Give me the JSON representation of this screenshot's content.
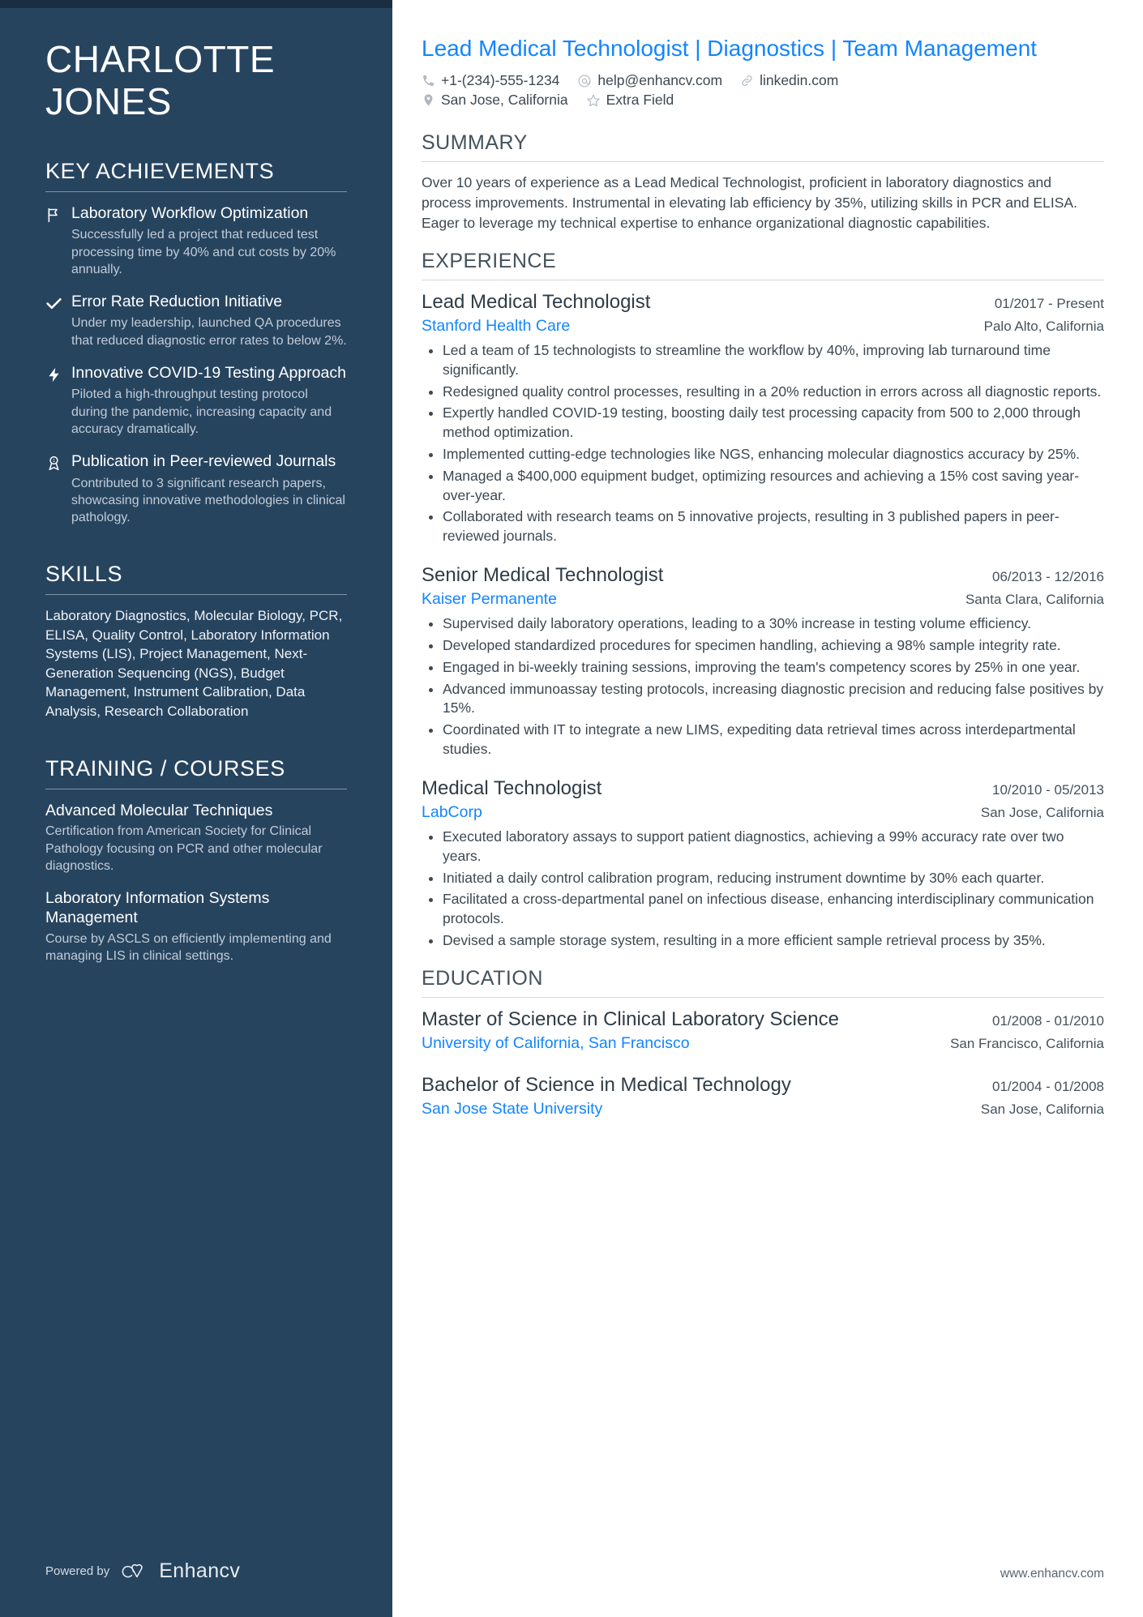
{
  "sidebar": {
    "name_lines": [
      "CHARLOTTE",
      "JONES"
    ],
    "achievements_heading": "KEY ACHIEVEMENTS",
    "achievements": [
      {
        "icon": "flag-icon",
        "title": "Laboratory Workflow Optimization",
        "description": "Successfully led a project that reduced test processing time by 40% and cut costs by 20% annually."
      },
      {
        "icon": "check-icon",
        "title": "Error Rate Reduction Initiative",
        "description": "Under my leadership, launched QA procedures that reduced diagnostic error rates to below 2%."
      },
      {
        "icon": "lightning-bolt-icon",
        "title": "Innovative COVID-19 Testing Approach",
        "description": "Piloted a high-throughput testing protocol during the pandemic, increasing capacity and accuracy dramatically."
      },
      {
        "icon": "award-ribbon-icon",
        "title": "Publication in Peer-reviewed Journals",
        "description": "Contributed to 3 significant research papers, showcasing innovative methodologies in clinical pathology."
      }
    ],
    "skills_heading": "SKILLS",
    "skills_text": "Laboratory Diagnostics, Molecular Biology, PCR, ELISA, Quality Control, Laboratory Information Systems (LIS), Project Management, Next-Generation Sequencing (NGS), Budget Management, Instrument Calibration, Data Analysis, Research Collaboration",
    "training_heading": "TRAINING / COURSES",
    "courses": [
      {
        "title": "Advanced Molecular Techniques",
        "description": "Certification from American Society for Clinical Pathology focusing on PCR and other molecular diagnostics."
      },
      {
        "title": "Laboratory Information Systems Management",
        "description": "Course by ASCLS on efficiently implementing and managing LIS in clinical settings."
      }
    ],
    "footer": {
      "powered_by": "Powered by",
      "brand": "Enhancv"
    }
  },
  "main": {
    "headline": "Lead Medical Technologist | Diagnostics | Team Management",
    "contacts_row1": [
      {
        "icon": "phone-icon",
        "text": "+1-(234)-555-1234"
      },
      {
        "icon": "email-at-icon",
        "text": "help@enhancv.com"
      },
      {
        "icon": "link-icon",
        "text": "linkedin.com"
      }
    ],
    "contacts_row2": [
      {
        "icon": "location-pin-icon",
        "text": "San Jose, California"
      },
      {
        "icon": "star-icon",
        "text": "Extra Field"
      }
    ],
    "summary_heading": "SUMMARY",
    "summary_text": "Over 10 years of experience as a Lead Medical Technologist, proficient in laboratory diagnostics and process improvements. Instrumental in elevating lab efficiency by 35%, utilizing skills in PCR and ELISA. Eager to leverage my technical expertise to enhance organizational diagnostic capabilities.",
    "experience_heading": "EXPERIENCE",
    "experience": [
      {
        "role": "Lead Medical Technologist",
        "date": "01/2017 - Present",
        "org": "Stanford Health Care",
        "location": "Palo Alto, California",
        "bullets": [
          "Led a team of 15 technologists to streamline the workflow by 40%, improving lab turnaround time significantly.",
          "Redesigned quality control processes, resulting in a 20% reduction in errors across all diagnostic reports.",
          "Expertly handled COVID-19 testing, boosting daily test processing capacity from 500 to 2,000 through method optimization.",
          "Implemented cutting-edge technologies like NGS, enhancing molecular diagnostics accuracy by 25%.",
          "Managed a $400,000 equipment budget, optimizing resources and achieving a 15% cost saving year-over-year.",
          "Collaborated with research teams on 5 innovative projects, resulting in 3 published papers in peer-reviewed journals."
        ]
      },
      {
        "role": "Senior Medical Technologist",
        "date": "06/2013 - 12/2016",
        "org": "Kaiser Permanente",
        "location": "Santa Clara, California",
        "bullets": [
          "Supervised daily laboratory operations, leading to a 30% increase in testing volume efficiency.",
          "Developed standardized procedures for specimen handling, achieving a 98% sample integrity rate.",
          "Engaged in bi-weekly training sessions, improving the team's competency scores by 25% in one year.",
          "Advanced immunoassay testing protocols, increasing diagnostic precision and reducing false positives by 15%.",
          "Coordinated with IT to integrate a new LIMS, expediting data retrieval times across interdepartmental studies."
        ]
      },
      {
        "role": "Medical Technologist",
        "date": "10/2010 - 05/2013",
        "org": "LabCorp",
        "location": "San Jose, California",
        "bullets": [
          "Executed laboratory assays to support patient diagnostics, achieving a 99% accuracy rate over two years.",
          "Initiated a daily control calibration program, reducing instrument downtime by 30% each quarter.",
          "Facilitated a cross-departmental panel on infectious disease, enhancing interdisciplinary communication protocols.",
          "Devised a sample storage system, resulting in a more efficient sample retrieval process by 35%."
        ]
      }
    ],
    "education_heading": "EDUCATION",
    "education": [
      {
        "degree": "Master of Science in Clinical Laboratory Science",
        "date": "01/2008 - 01/2010",
        "school": "University of California, San Francisco",
        "location": "San Francisco, California"
      },
      {
        "degree": "Bachelor of Science in Medical Technology",
        "date": "01/2004 - 01/2008",
        "school": "San Jose State University",
        "location": "San Jose, California"
      }
    ],
    "footer_url": "www.enhancv.com"
  },
  "colors": {
    "sidebar_bg": "#27445f",
    "sidebar_top_strip": "#1b2d40",
    "accent_blue": "#1285ff",
    "body_text": "#3c4852"
  }
}
